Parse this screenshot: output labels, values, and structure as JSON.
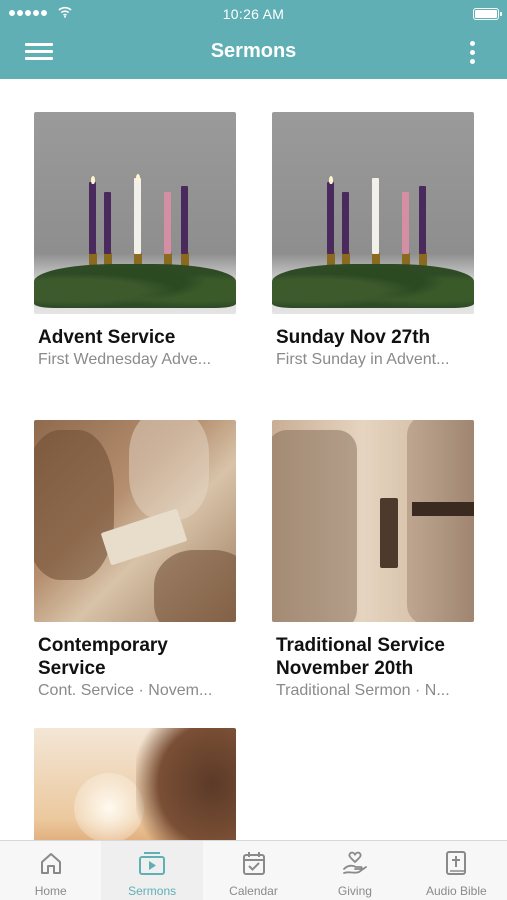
{
  "status_bar": {
    "time": "10:26 AM"
  },
  "header": {
    "title": "Sermons"
  },
  "sermons": [
    {
      "title": "Advent Service",
      "subtitle": "First Wednesday Adve..."
    },
    {
      "title": "Sunday Nov 27th",
      "subtitle": "First Sunday in Advent..."
    },
    {
      "title": "Contemporary Service",
      "subtitle": "Cont. Service · Novem..."
    },
    {
      "title": "Traditional Service November 20th",
      "subtitle": "Traditional Sermon · N..."
    },
    {
      "title": "",
      "subtitle": ""
    }
  ],
  "tabs": [
    {
      "label": "Home",
      "icon": "home-icon"
    },
    {
      "label": "Sermons",
      "icon": "sermons-icon"
    },
    {
      "label": "Calendar",
      "icon": "calendar-icon"
    },
    {
      "label": "Giving",
      "icon": "giving-icon"
    },
    {
      "label": "Audio Bible",
      "icon": "bible-icon"
    }
  ],
  "colors": {
    "accent": "#5fafb5",
    "tab_inactive": "#8a8a8a"
  }
}
